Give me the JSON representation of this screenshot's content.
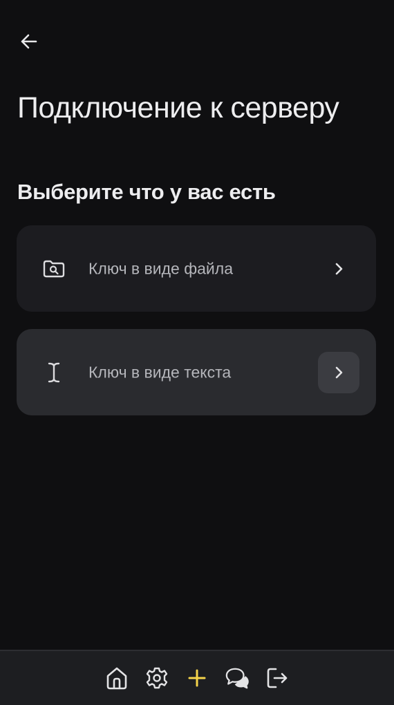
{
  "header": {
    "back_icon": "arrow-left-icon"
  },
  "page": {
    "title": "Подключение к серверу",
    "section_title": "Выберите что у вас есть"
  },
  "options": [
    {
      "label": "Ключ в виде файла",
      "icon": "folder-search-icon"
    },
    {
      "label": "Ключ в виде текста",
      "icon": "text-cursor-icon"
    }
  ],
  "bottom_nav": {
    "items": [
      {
        "icon": "home-icon"
      },
      {
        "icon": "gear-icon"
      },
      {
        "icon": "plus-icon"
      },
      {
        "icon": "chat-icon"
      },
      {
        "icon": "logout-icon"
      }
    ]
  },
  "colors": {
    "background": "#0f0f11",
    "card": "#1c1c20",
    "card_selected": "#2a2b2f",
    "accent": "#f5d44a",
    "text": "#ededef",
    "muted_text": "#b5b6bb"
  }
}
